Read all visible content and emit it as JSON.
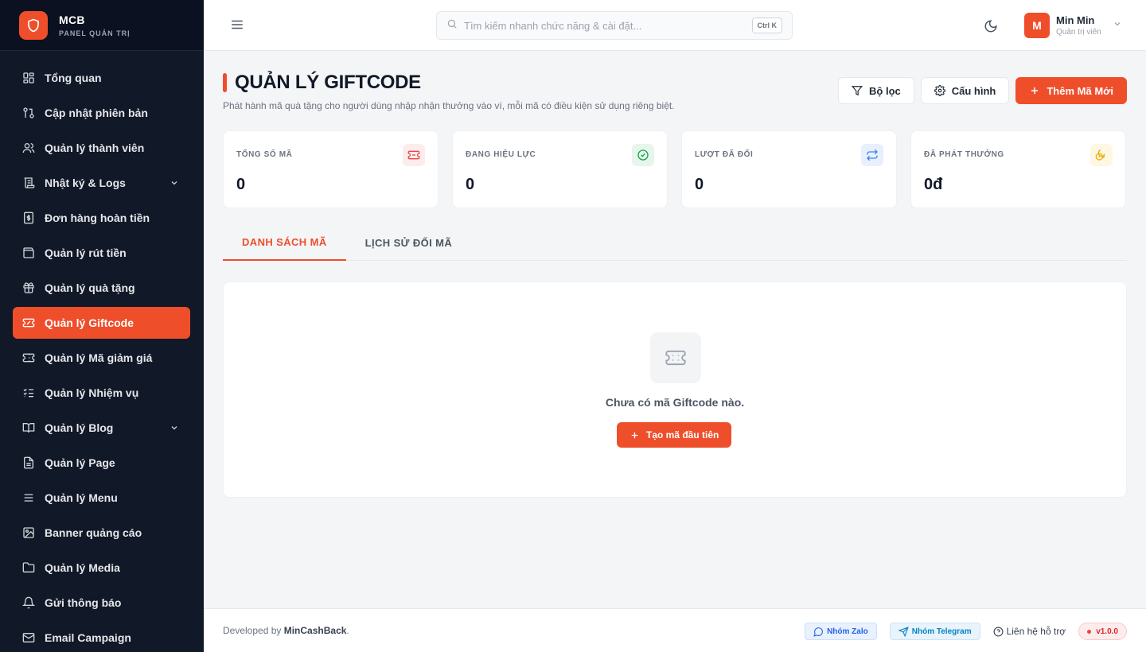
{
  "brand": {
    "name": "MCB",
    "subtitle": "PANEL QUẢN TRỊ"
  },
  "sidebar": {
    "items": [
      {
        "label": "Tổng quan",
        "icon": "dashboard-icon"
      },
      {
        "label": "Cập nhật phiên bản",
        "icon": "git-compare-icon"
      },
      {
        "label": "Quản lý thành viên",
        "icon": "users-icon"
      },
      {
        "label": "Nhật ký & Logs",
        "icon": "scroll-icon",
        "expandable": true
      },
      {
        "label": "Đơn hàng hoàn tiền",
        "icon": "receipt-dollar-icon"
      },
      {
        "label": "Quản lý rút tiền",
        "icon": "wallet-icon"
      },
      {
        "label": "Quản lý quà tặng",
        "icon": "gift-icon"
      },
      {
        "label": "Quản lý Giftcode",
        "icon": "ticket-icon",
        "active": true
      },
      {
        "label": "Quản lý Mã giảm giá",
        "icon": "discount-ticket-icon"
      },
      {
        "label": "Quản lý Nhiệm vụ",
        "icon": "checklist-icon"
      },
      {
        "label": "Quản lý Blog",
        "icon": "book-icon",
        "expandable": true
      },
      {
        "label": "Quản lý Page",
        "icon": "file-icon"
      },
      {
        "label": "Quản lý Menu",
        "icon": "menu-lines-icon"
      },
      {
        "label": "Banner quảng cáo",
        "icon": "image-icon"
      },
      {
        "label": "Quản lý Media",
        "icon": "folder-icon"
      },
      {
        "label": "Gửi thông báo",
        "icon": "bell-icon"
      },
      {
        "label": "Email Campaign",
        "icon": "mail-icon"
      }
    ]
  },
  "header": {
    "search_placeholder": "Tìm kiếm nhanh chức năng & cài đặt...",
    "shortcut": "Ctrl K",
    "user_name": "Min Min",
    "user_role": "Quản trị viên",
    "avatar_initial": "M"
  },
  "page": {
    "title": "QUẢN LÝ GIFTCODE",
    "description": "Phát hành mã quà tặng cho người dùng nhập nhận thưởng vào ví, mỗi mã có điều kiện sử dụng riêng biệt.",
    "filter_label": "Bộ lọc",
    "config_label": "Cấu hình",
    "add_label": "Thêm Mã Mới"
  },
  "stats": [
    {
      "label": "TỔNG SỐ MÃ",
      "value": "0",
      "icon": "ticket-icon",
      "color": "#ef4444",
      "bg": "#fdecec"
    },
    {
      "label": "ĐANG HIỆU LỰC",
      "value": "0",
      "icon": "check-circle-icon",
      "color": "#16a34a",
      "bg": "#e7f6ec"
    },
    {
      "label": "LƯỢT ĐÃ ĐỔI",
      "value": "0",
      "icon": "repeat-icon",
      "color": "#3b82f6",
      "bg": "#e8f0fd"
    },
    {
      "label": "ĐÃ PHÁT THƯỞNG",
      "value": "0đ",
      "icon": "coins-icon",
      "color": "#eab308",
      "bg": "#fdf7e3"
    }
  ],
  "tabs": [
    {
      "label": "DANH SÁCH MÃ",
      "active": true
    },
    {
      "label": "LỊCH SỬ ĐỔI MÃ",
      "active": false
    }
  ],
  "empty": {
    "text": "Chưa có mã Giftcode nào.",
    "button": "Tạo mã đầu tiên"
  },
  "footer": {
    "prefix": "Developed by ",
    "author": "MinCashBack",
    "suffix": ".",
    "zalo": "Nhóm Zalo",
    "telegram": "Nhóm Telegram",
    "support": "Liên hệ hỗ trợ",
    "version": "v1.0.0"
  },
  "colors": {
    "accent": "#ef4e2b",
    "sidebar_bg": "#111827"
  }
}
